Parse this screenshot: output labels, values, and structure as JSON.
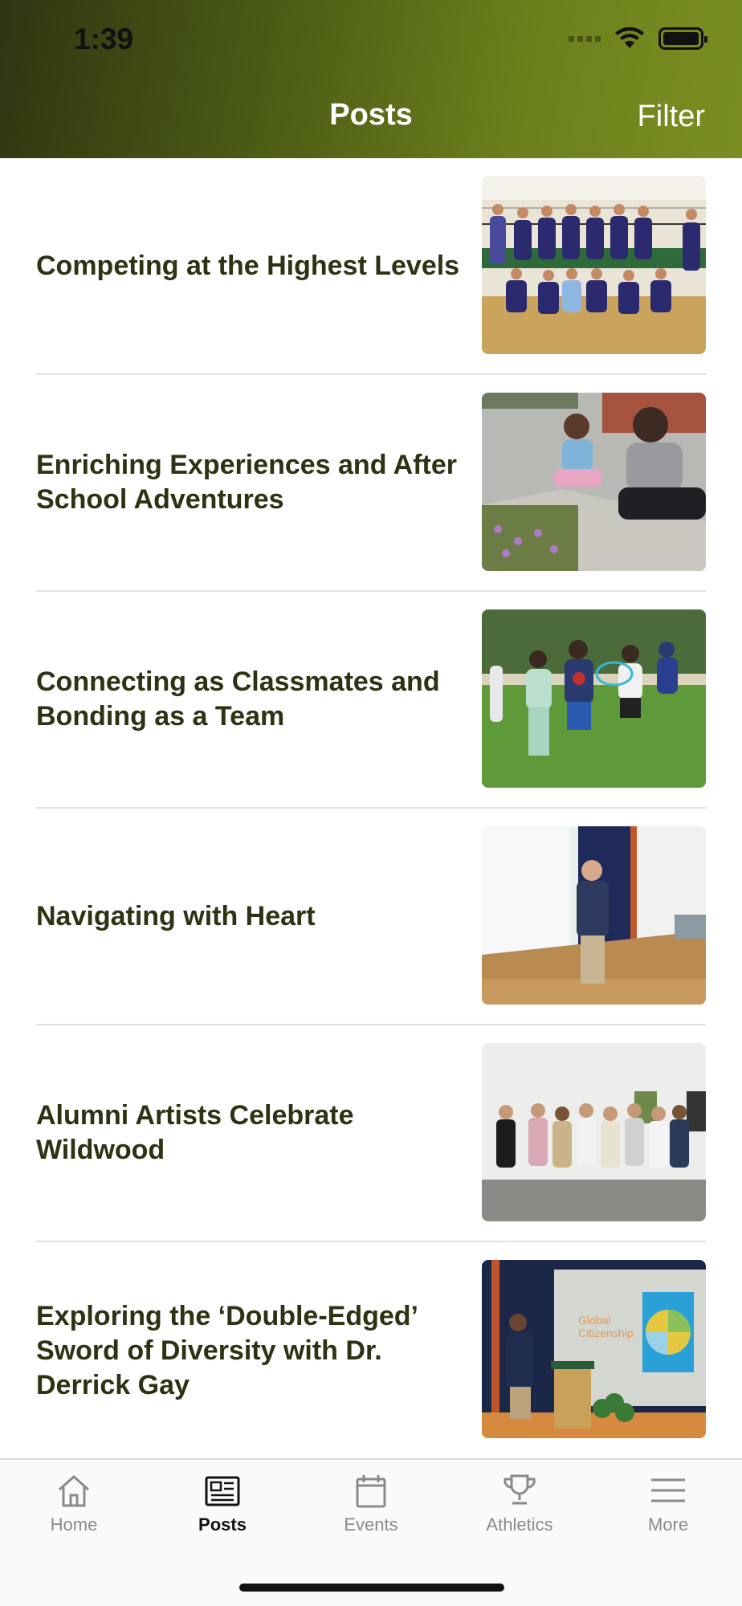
{
  "status_bar": {
    "time": "1:39"
  },
  "header": {
    "title": "Posts",
    "filter_label": "Filter"
  },
  "posts": [
    {
      "title": "Competing at the Highest Levels",
      "image": "volleyball team photo"
    },
    {
      "title": "Enriching Experiences and After School Adventures",
      "image": "girl and woman sitting outside"
    },
    {
      "title": "Connecting as Classmates and Bonding as a Team",
      "image": "students holding hands on field"
    },
    {
      "title": "Navigating with Heart",
      "image": "man speaking on stage"
    },
    {
      "title": "Alumni Artists Celebrate Wildwood",
      "image": "group photo at gallery"
    },
    {
      "title": "Exploring the ‘Double-Edged’ Sword of Diversity with Dr. Derrick Gay",
      "image": "speaker at podium with slide"
    }
  ],
  "tabbar": {
    "items": [
      {
        "label": "Home",
        "icon": "home-icon",
        "active": false
      },
      {
        "label": "Posts",
        "icon": "newspaper-icon",
        "active": true
      },
      {
        "label": "Events",
        "icon": "calendar-icon",
        "active": false
      },
      {
        "label": "Athletics",
        "icon": "trophy-icon",
        "active": false
      },
      {
        "label": "More",
        "icon": "menu-icon",
        "active": false
      }
    ]
  },
  "colors": {
    "header_start": "#2f3512",
    "header_end": "#7a8f22",
    "title_text": "#2c3212",
    "tab_inactive": "#8a8a8a"
  }
}
